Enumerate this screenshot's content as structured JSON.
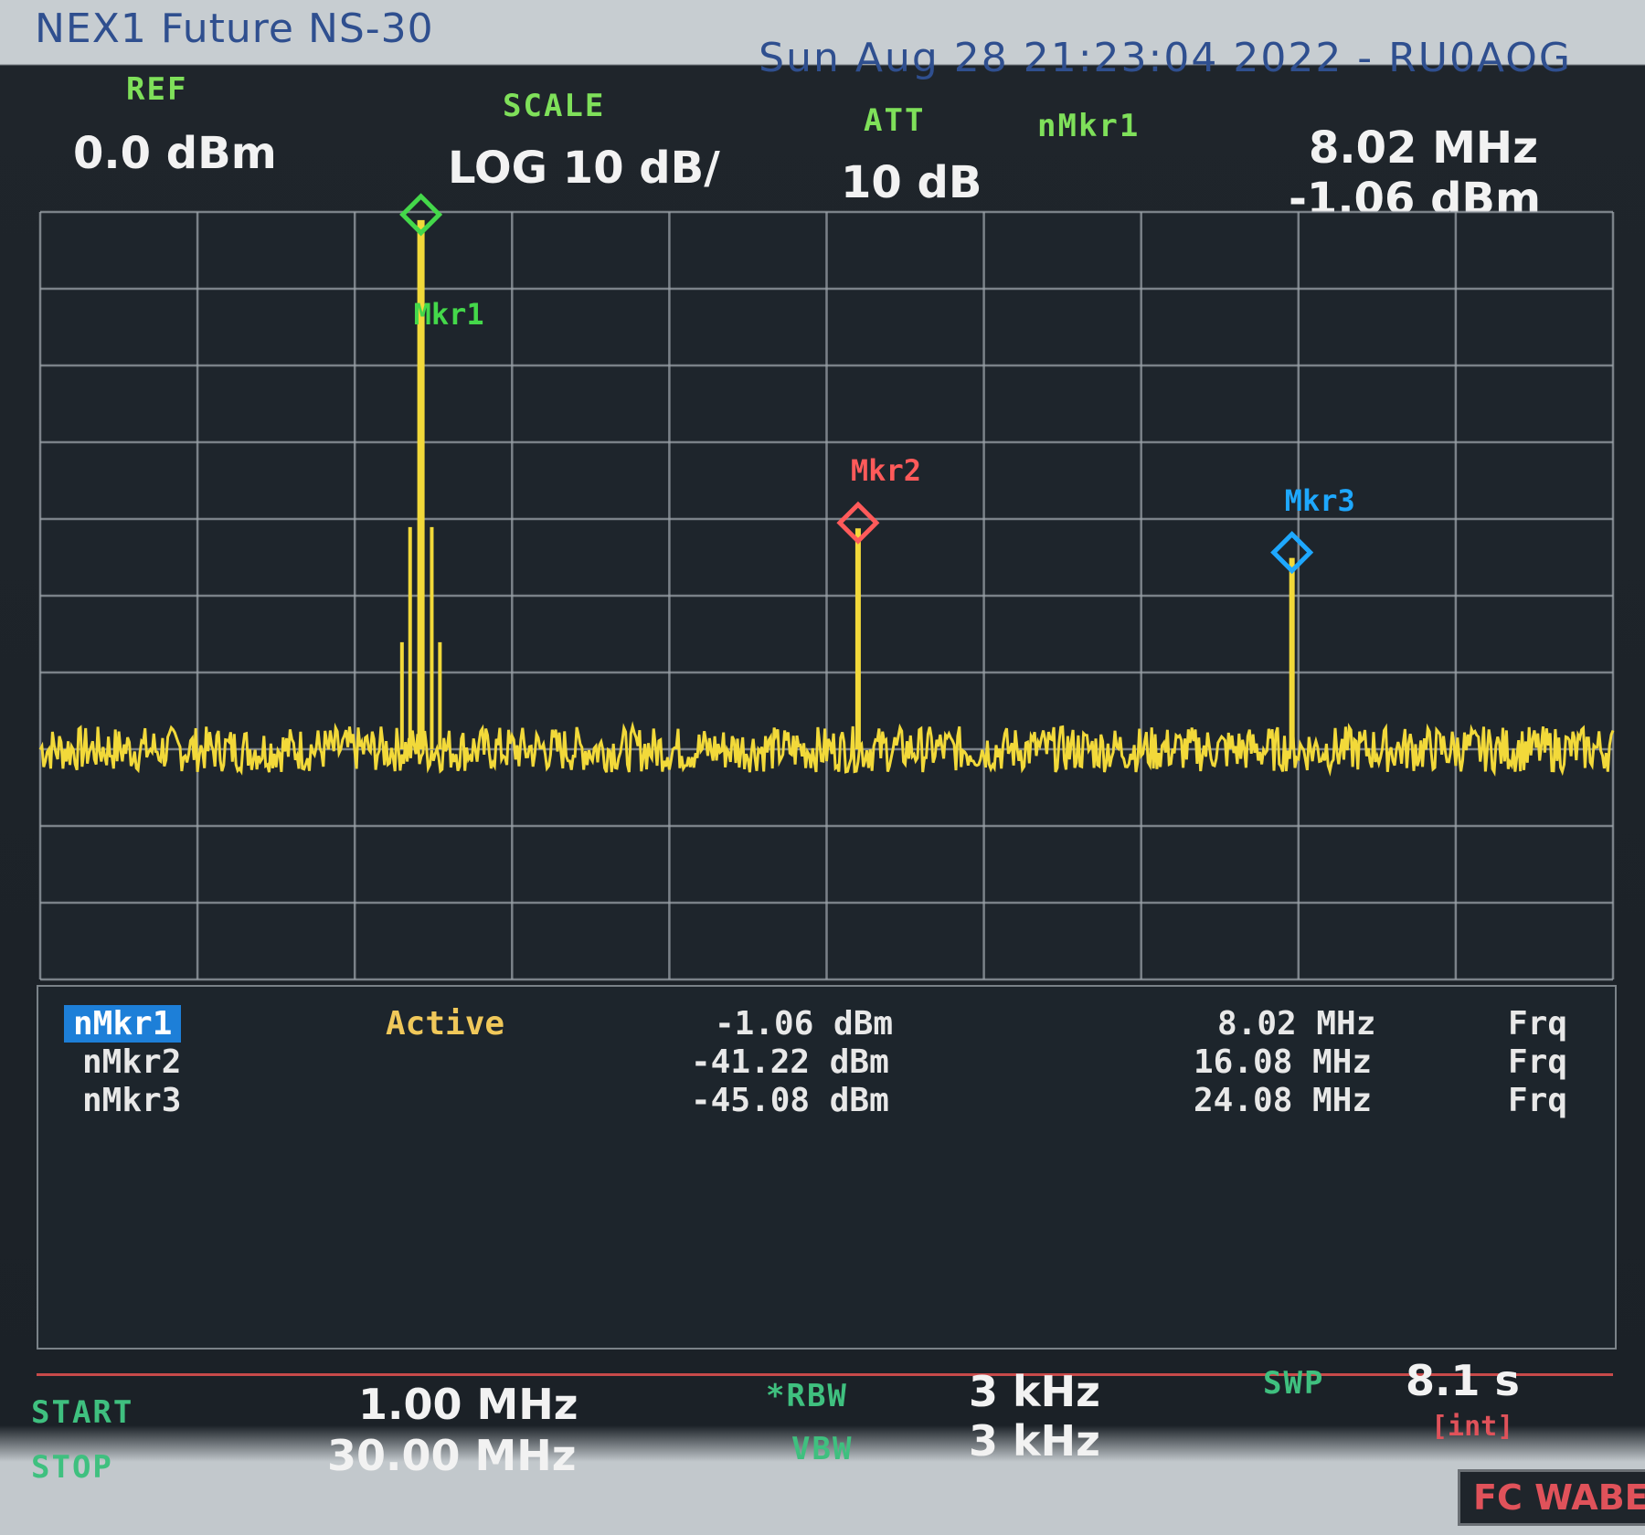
{
  "header": {
    "instrument": "NEX1 Future NS-30",
    "datetime": "Sun Aug 28 21:23:04 2022 - RU0AOG",
    "ref_label": "REF",
    "ref_value": "0.0 dBm",
    "scale_label": "SCALE",
    "scale_value": "LOG 10 dB/",
    "att_label": "ATT",
    "att_value": "10 dB",
    "active_marker_label": "nMkr1",
    "active_marker_freq": "8.02 MHz",
    "active_marker_level": "-1.06 dBm"
  },
  "trace": {
    "colors": {
      "trace": "#f2d93a",
      "grid": "#9aa1a8",
      "mkr1": "#44d84a",
      "mkr2": "#ff5a5a",
      "mkr3": "#1ea8ff"
    },
    "start_mhz": 1.0,
    "stop_mhz": 30.0,
    "ref_dbm": 0,
    "db_per_div": 10,
    "noise_floor_dbm": -70,
    "peaks": [
      {
        "freq_mhz": 8.02,
        "level_dbm": -1.06
      },
      {
        "freq_mhz": 16.08,
        "level_dbm": -41.22
      },
      {
        "freq_mhz": 24.08,
        "level_dbm": -45.08
      }
    ],
    "marker_labels": [
      "Mkr1",
      "Mkr2",
      "Mkr3"
    ]
  },
  "markers": [
    {
      "name": "nMkr1",
      "state": "Active",
      "level": "-1.06 dBm",
      "freq": "8.02 MHz",
      "mode": "Frq"
    },
    {
      "name": "nMkr2",
      "state": "",
      "level": "-41.22 dBm",
      "freq": "16.08 MHz",
      "mode": "Frq"
    },
    {
      "name": "nMkr3",
      "state": "",
      "level": "-45.08 dBm",
      "freq": "24.08 MHz",
      "mode": "Frq"
    }
  ],
  "footer": {
    "start_label": "START",
    "start_value": "1.00 MHz",
    "stop_label": "STOP",
    "stop_value": "30.00 MHz",
    "rbw_label": "*RBW",
    "rbw_value": "3 kHz",
    "vbw_label": "VBW",
    "vbw_value": "3 kHz",
    "swp_label": "SWP",
    "swp_value": "8.1 s",
    "swp_mode": "[int]",
    "fc_badge": "FC WABE"
  }
}
